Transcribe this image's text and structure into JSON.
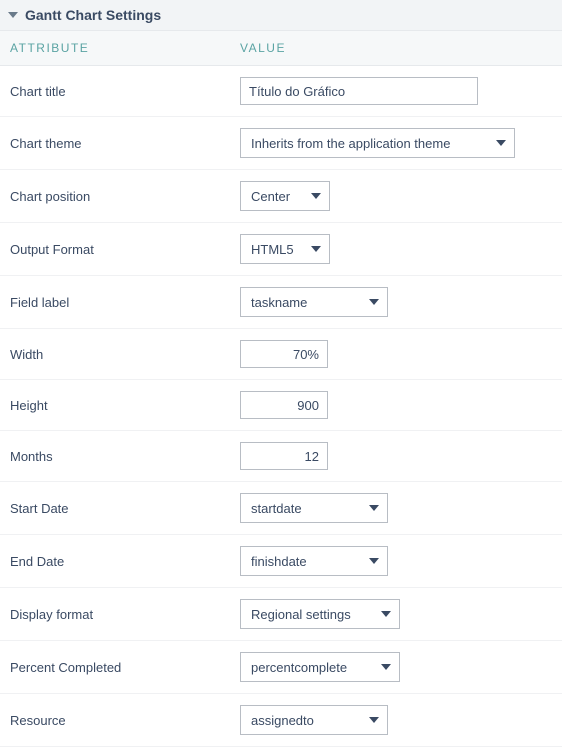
{
  "panel": {
    "title": "Gantt Chart Settings"
  },
  "columns": {
    "attribute": "ATTRIBUTE",
    "value": "VALUE"
  },
  "rows": {
    "chart_title": {
      "label": "Chart title",
      "value": "Título do Gráfico"
    },
    "chart_theme": {
      "label": "Chart theme",
      "value": "Inherits from the application theme"
    },
    "chart_position": {
      "label": "Chart position",
      "value": "Center"
    },
    "output_format": {
      "label": "Output Format",
      "value": "HTML5"
    },
    "field_label": {
      "label": "Field label",
      "value": "taskname"
    },
    "width": {
      "label": "Width",
      "value": "70%"
    },
    "height": {
      "label": "Height",
      "value": "900"
    },
    "months": {
      "label": "Months",
      "value": "12"
    },
    "start_date": {
      "label": "Start Date",
      "value": "startdate"
    },
    "end_date": {
      "label": "End Date",
      "value": "finishdate"
    },
    "display_format": {
      "label": "Display format",
      "value": "Regional settings"
    },
    "percent_completed": {
      "label": "Percent Completed",
      "value": "percentcomplete"
    },
    "resource": {
      "label": "Resource",
      "value": "assignedto"
    }
  }
}
